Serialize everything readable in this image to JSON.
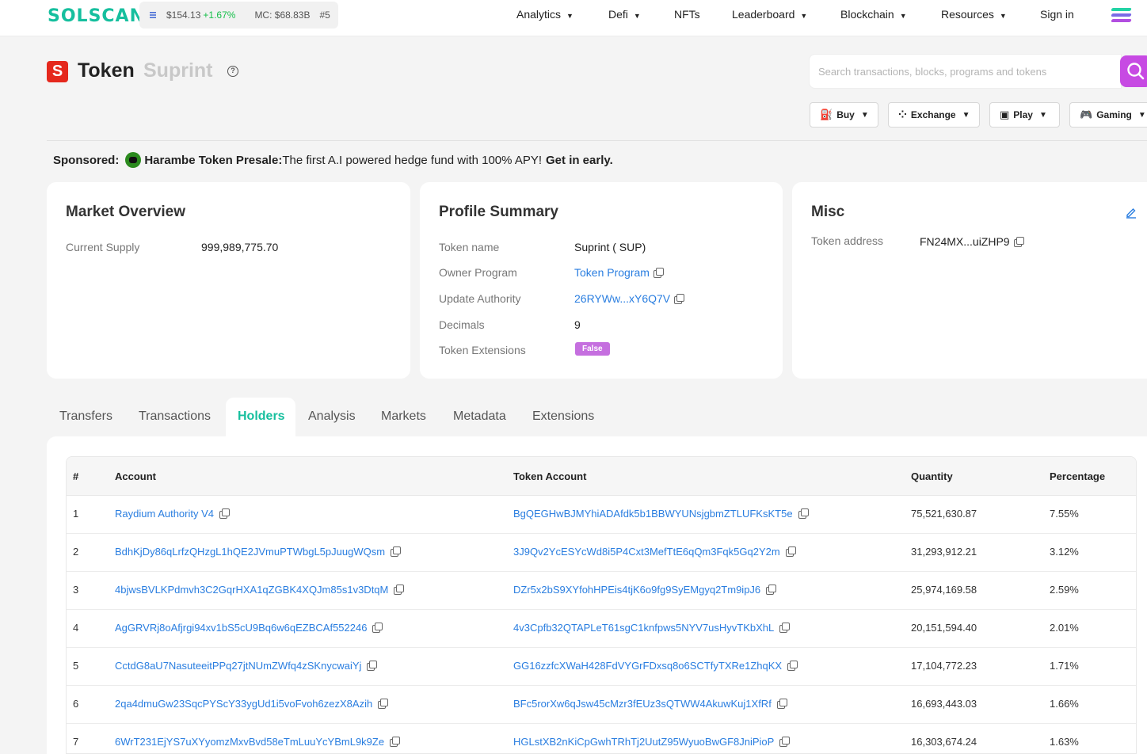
{
  "header": {
    "logo": "SOLSCAN",
    "sol_price": "$154.13",
    "sol_change": "+1.67%",
    "market_cap": "MC: $68.83B",
    "rank": "#5",
    "nav": [
      {
        "label": "Analytics",
        "caret": true
      },
      {
        "label": "Defi",
        "caret": true
      },
      {
        "label": "NFTs",
        "caret": false
      },
      {
        "label": "Leaderboard",
        "caret": true
      },
      {
        "label": "Blockchain",
        "caret": true
      },
      {
        "label": "Resources",
        "caret": true
      },
      {
        "label": "Sign in",
        "caret": false
      }
    ]
  },
  "page": {
    "logo_letter": "S",
    "title_word": "Token",
    "token_name": "Suprint",
    "help": "?"
  },
  "search": {
    "placeholder": "Search transactions, blocks, programs and tokens"
  },
  "quick_buttons": [
    "Buy",
    "Exchange",
    "Play",
    "Gaming"
  ],
  "sponsored": {
    "label": "Sponsored:",
    "name": "Harambe Token Presale:",
    "text": "The first A.I powered hedge fund with 100% APY!",
    "cta": "Get in early."
  },
  "market_overview": {
    "title": "Market Overview",
    "supply_label": "Current Supply",
    "supply_value": "999,989,775.70"
  },
  "profile_summary": {
    "title": "Profile Summary",
    "token_name_label": "Token name",
    "token_name_value": "Suprint ( SUP)",
    "owner_label": "Owner Program",
    "owner_value": "Token Program",
    "update_label": "Update Authority",
    "update_value": "26RYWw...xY6Q7V",
    "decimals_label": "Decimals",
    "decimals_value": "9",
    "extensions_label": "Token Extensions",
    "extensions_value": "False"
  },
  "misc": {
    "title": "Misc",
    "address_label": "Token address",
    "address_value": "FN24MX...uiZHP9"
  },
  "tabs": [
    "Transfers",
    "Transactions",
    "Holders",
    "Analysis",
    "Markets",
    "Metadata",
    "Extensions"
  ],
  "active_tab": "Holders",
  "table": {
    "headers": [
      "#",
      "Account",
      "Token Account",
      "Quantity",
      "Percentage"
    ],
    "rows": [
      {
        "rank": "1",
        "account": "Raydium Authority V4",
        "token_account": "BgQEGHwBJMYhiADAfdk5b1BBWYUNsjgbmZTLUFKsKT5e",
        "quantity": "75,521,630.87",
        "percentage": "7.55%"
      },
      {
        "rank": "2",
        "account": "BdhKjDy86qLrfzQHzgL1hQE2JVmuPTWbgL5pJuugWQsm",
        "token_account": "3J9Qv2YcESYcWd8i5P4Cxt3MefTtE6qQm3Fqk5Gq2Y2m",
        "quantity": "31,293,912.21",
        "percentage": "3.12%"
      },
      {
        "rank": "3",
        "account": "4bjwsBVLKPdmvh3C2GqrHXA1qZGBK4XQJm85s1v3DtqM",
        "token_account": "DZr5x2bS9XYfohHPEis4tjK6o9fg9SyEMgyq2Tm9ipJ6",
        "quantity": "25,974,169.58",
        "percentage": "2.59%"
      },
      {
        "rank": "4",
        "account": "AgGRVRj8oAfjrgi94xv1bS5cU9Bq6w6qEZBCAf552246",
        "token_account": "4v3Cpfb32QTAPLeT61sgC1knfpws5NYV7usHyvTKbXhL",
        "quantity": "20,151,594.40",
        "percentage": "2.01%"
      },
      {
        "rank": "5",
        "account": "CctdG8aU7NasuteeitPPq27jtNUmZWfq4zSKnycwaiYj",
        "token_account": "GG16zzfcXWaH428FdVYGrFDxsq8o6SCTfyTXRe1ZhqKX",
        "quantity": "17,104,772.23",
        "percentage": "1.71%"
      },
      {
        "rank": "6",
        "account": "2qa4dmuGw23SqcPYScY33ygUd1i5voFvoh6zezX8Azih",
        "token_account": "BFc5rorXw6qJsw45cMzr3fEUz3sQTWW4AkuwKuj1XfRf",
        "quantity": "16,693,443.03",
        "percentage": "1.66%"
      },
      {
        "rank": "7",
        "account": "6WrT231EjYS7uXYyomzMxvBvd58eTmLuuYcYBmL9k9Ze",
        "token_account": "HGLstXB2nKiCpGwhTRhTj2UutZ95WyuoBwGF8JniPioP",
        "quantity": "16,303,674.24",
        "percentage": "1.63%"
      }
    ]
  },
  "colors": {
    "brand": "#16bf9e",
    "link": "#2a7ee0",
    "search_button": "#c74ae3",
    "badge_false": "#c56fdf",
    "token_logo": "#e5281d",
    "price_up": "#16bf4a"
  }
}
